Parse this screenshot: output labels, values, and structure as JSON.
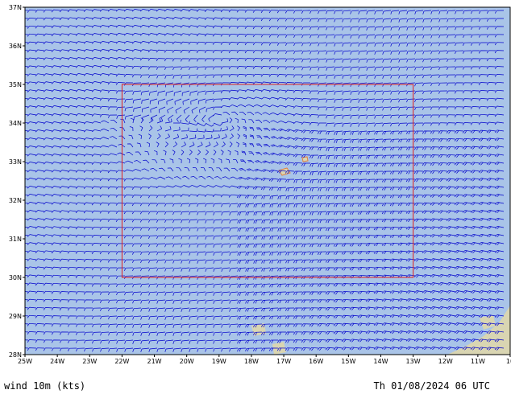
{
  "map": {
    "lat_ticks": [
      "37N",
      "36N",
      "35N",
      "34N",
      "33N",
      "32N",
      "31N",
      "30N",
      "29N",
      "28N"
    ],
    "lon_ticks": [
      "25W",
      "24W",
      "23W",
      "22W",
      "21W",
      "20W",
      "19W",
      "18W",
      "17W",
      "16W",
      "15W",
      "14W",
      "13W",
      "12W",
      "11W",
      "10"
    ],
    "extent": {
      "lon": [
        -25,
        -10
      ],
      "lat": [
        28,
        37
      ]
    },
    "subdomain": {
      "lon": [
        -22,
        -13
      ],
      "lat": [
        30,
        35
      ]
    },
    "colors": {
      "sea": "#a9c4e8",
      "land": "#d9d5b2",
      "barbs": "#0000cc",
      "subdomain_box": "#dd2222",
      "axis": "#000000"
    }
  },
  "footer": {
    "left": "wind 10m (kts)",
    "right": "Th 01/08/2024 06 UTC"
  }
}
